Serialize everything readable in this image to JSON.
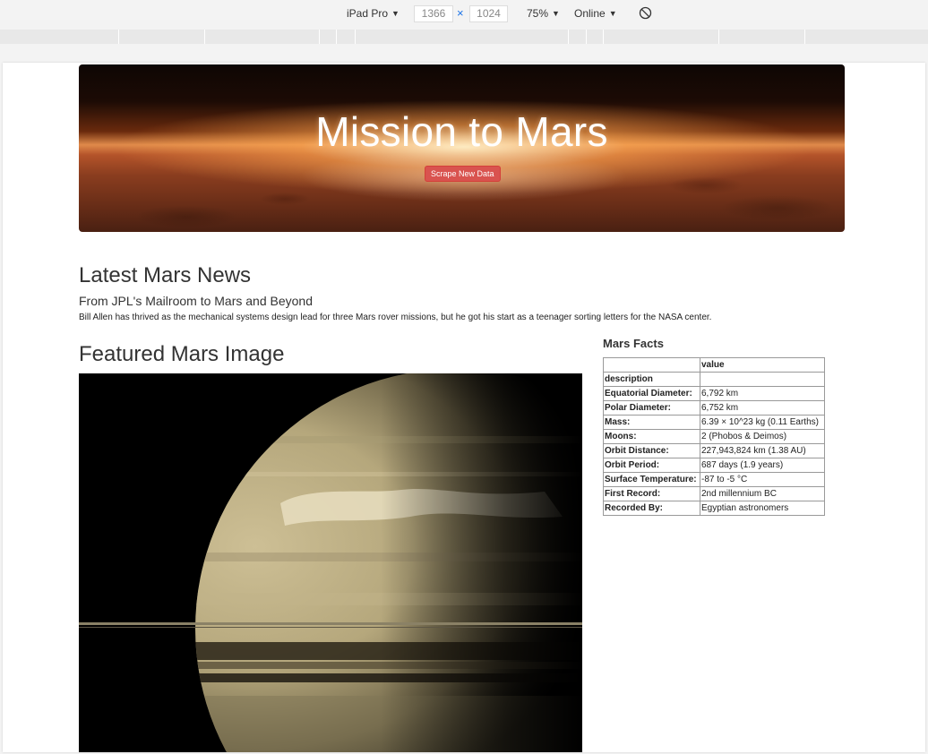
{
  "devtools": {
    "device": "iPad Pro",
    "width": "1366",
    "times": "×",
    "height": "1024",
    "zoom": "75%",
    "network": "Online"
  },
  "hero": {
    "title": "Mission to Mars",
    "button_label": "Scrape New Data"
  },
  "news": {
    "heading": "Latest Mars News",
    "title": "From JPL's Mailroom to Mars and Beyond",
    "paragraph": "Bill Allen has thrived as the mechanical systems design lead for three Mars rover missions, but he got his start as a teenager sorting letters for the NASA center."
  },
  "featured": {
    "heading": "Featured Mars Image"
  },
  "facts": {
    "heading": "Mars Facts",
    "header_col2": "value",
    "header_row_label": "description",
    "rows": [
      {
        "label": "Equatorial Diameter:",
        "value": "6,792 km"
      },
      {
        "label": "Polar Diameter:",
        "value": "6,752 km"
      },
      {
        "label": "Mass:",
        "value": "6.39 × 10^23 kg (0.11 Earths)"
      },
      {
        "label": "Moons:",
        "value": "2 (Phobos & Deimos)"
      },
      {
        "label": "Orbit Distance:",
        "value": "227,943,824 km (1.38 AU)"
      },
      {
        "label": "Orbit Period:",
        "value": "687 days (1.9 years)"
      },
      {
        "label": "Surface Temperature:",
        "value": "-87 to -5 °C"
      },
      {
        "label": "First Record:",
        "value": "2nd millennium BC"
      },
      {
        "label": "Recorded By:",
        "value": "Egyptian astronomers"
      }
    ]
  }
}
